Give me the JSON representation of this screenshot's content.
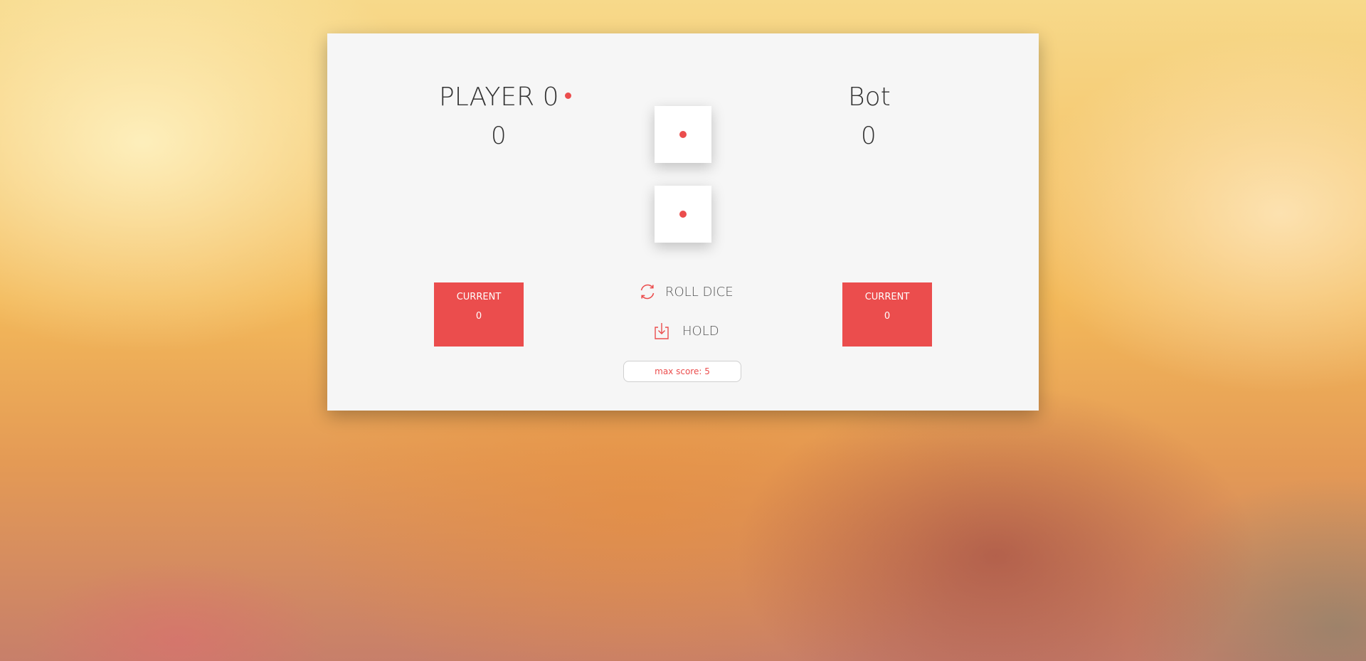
{
  "players": [
    {
      "name": "PLAYER 0",
      "score": "0",
      "active": true,
      "current_label": "CURRENT",
      "current_value": "0"
    },
    {
      "name": "Bot",
      "score": "0",
      "active": false,
      "current_label": "CURRENT",
      "current_value": "0"
    }
  ],
  "dice": [
    {
      "value": 1
    },
    {
      "value": 1
    }
  ],
  "controls": {
    "roll_label": "ROLL DICE",
    "roll_icon": "refresh-icon",
    "hold_label": "HOLD",
    "hold_icon": "download-icon"
  },
  "max_score": {
    "value": "max score: 5"
  },
  "colors": {
    "accent": "#eb4d4d",
    "panel": "#f6f6f6",
    "text": "#333333"
  }
}
